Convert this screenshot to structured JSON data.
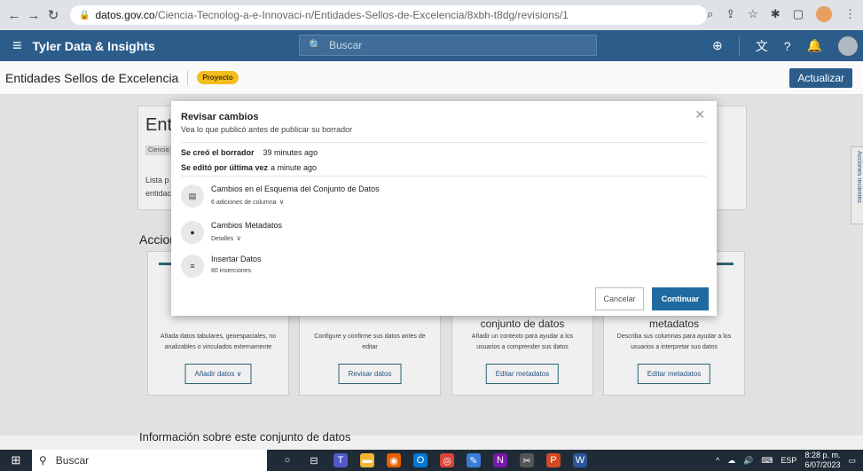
{
  "browser": {
    "url_host": "datos.gov.co",
    "url_path": "/Ciencia-Tecnolog-a-e-Innovaci-n/Entidades-Sellos-de-Excelencia/8xbh-t8dg/revisions/1"
  },
  "app": {
    "title": "Tyler Data & Insights",
    "search_placeholder": "Buscar"
  },
  "subheader": {
    "title": "Entidades Sellos de Excelencia",
    "badge": "Proyecto",
    "update_button": "Actualizar"
  },
  "background": {
    "info_title": "Enti",
    "info_chip": "Ciencia",
    "info_desc_1": "Lista p",
    "info_desc_2": "entidac",
    "acciones": "Accion",
    "side_tab": "Acciones recientes",
    "steps": [
      {
        "title": "",
        "desc": "Añada datos tabulares, geoespaciales, no analizables o vinculados externamente",
        "button": "Añadir datos"
      },
      {
        "title": "",
        "desc": "Configure y confirme sus datos antes de editar",
        "button": "Revisar datos"
      },
      {
        "title": "conjunto de datos",
        "desc": "Añadir un contexto para ayudar a los usuarios a comprender sus datos",
        "button": "Editar metadatos"
      },
      {
        "title": "metadatos",
        "desc": "Describa sus columnas para ayudar a los usuarios a interpretar sus datos",
        "button": "Editar metadatos"
      }
    ],
    "info_section_title": "Información sobre este conjunto de datos"
  },
  "modal": {
    "title": "Revisar cambios",
    "subtitle": "Vea lo que publicó antes de publicar su borrador",
    "created_label": "Se creó el borrador",
    "created_value": "39 minutes ago",
    "edited_label": "Se editó por última vez",
    "edited_value": "a minute ago",
    "changes": [
      {
        "title": "Cambios en el Esquema del Conjunto de Datos",
        "sub": "6 adiciones de columna"
      },
      {
        "title": "Cambios Metadatos",
        "sub": "Detalles"
      },
      {
        "title": "Insertar Datos",
        "sub": "80 inserciones"
      }
    ],
    "cancel": "Cancelar",
    "continue": "Continuar"
  },
  "taskbar": {
    "search": "Buscar",
    "lang": "ESP",
    "time": "8:28 p. m.",
    "date": "6/07/2023"
  }
}
